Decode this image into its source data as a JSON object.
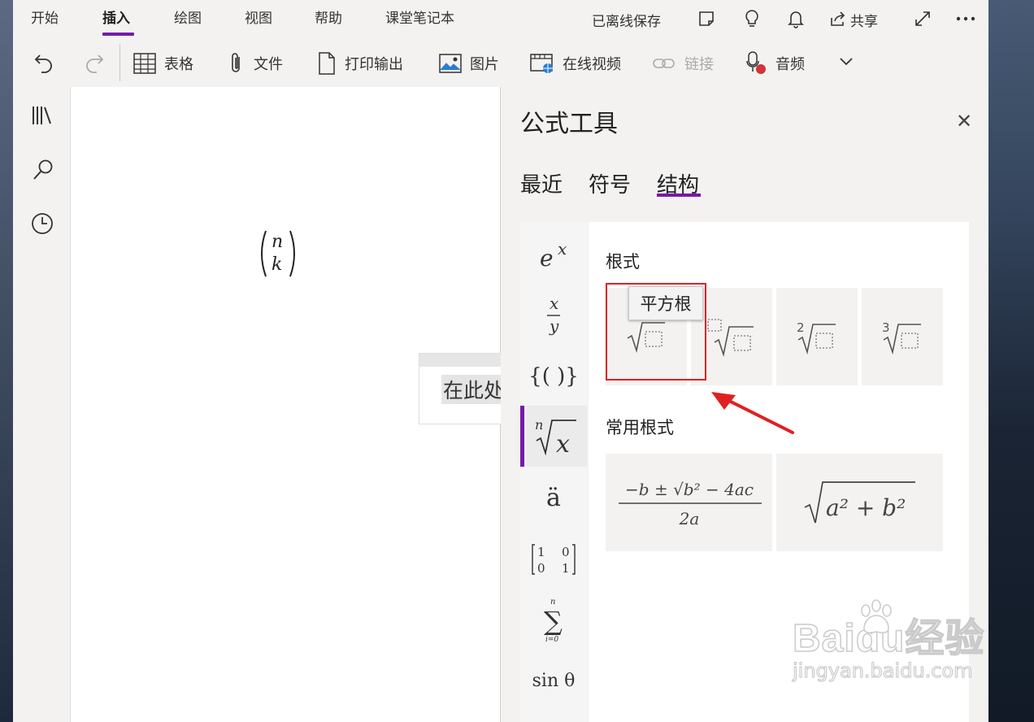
{
  "menu": {
    "tabs": [
      "开始",
      "插入",
      "绘图",
      "视图",
      "帮助",
      "课堂笔记本"
    ],
    "active_tab": "插入",
    "status": "已离线保存",
    "share": "共享"
  },
  "toolbar": {
    "table": "表格",
    "file": "文件",
    "printout": "打印输出",
    "picture": "图片",
    "online_video": "在线视频",
    "link": "链接",
    "audio": "音频"
  },
  "canvas": {
    "binom_top": "n",
    "binom_bottom": "k",
    "equation_placeholder": "在此处"
  },
  "panel": {
    "title": "公式工具",
    "tabs": [
      "最近",
      "符号",
      "结构"
    ],
    "active_tab": "结构",
    "categories": [
      "e^x",
      "x/y",
      "{()}",
      "ⁿ√x",
      "ä",
      "matrix",
      "Σ",
      "sin θ"
    ],
    "active_category": "ⁿ√x",
    "section_radicals": "根式",
    "section_common": "常用根式",
    "tooltip": "平方根",
    "cat_labels": {
      "exp_base": "e",
      "exp_sup": "x",
      "frac_num": "x",
      "frac_den": "y",
      "brackets": "{( )}",
      "root_index": "n",
      "root_body": "x",
      "accent": "ä",
      "mat_a": "1",
      "mat_b": "0",
      "mat_c": "0",
      "mat_d": "1",
      "sum_top": "n",
      "sum_bottom": "i=0",
      "func": "sin θ"
    },
    "tile_labels": {
      "index_2": "2",
      "index_3": "3",
      "quadratic_num": "−b ± √b² − 4ac",
      "quadratic_den": "2a",
      "pythag": "a² + b²"
    }
  },
  "watermark": {
    "brand": "Baidu经验",
    "url": "jingyan.baidu.com"
  },
  "colors": {
    "accent": "#7719aa",
    "highlight": "#e02020"
  }
}
